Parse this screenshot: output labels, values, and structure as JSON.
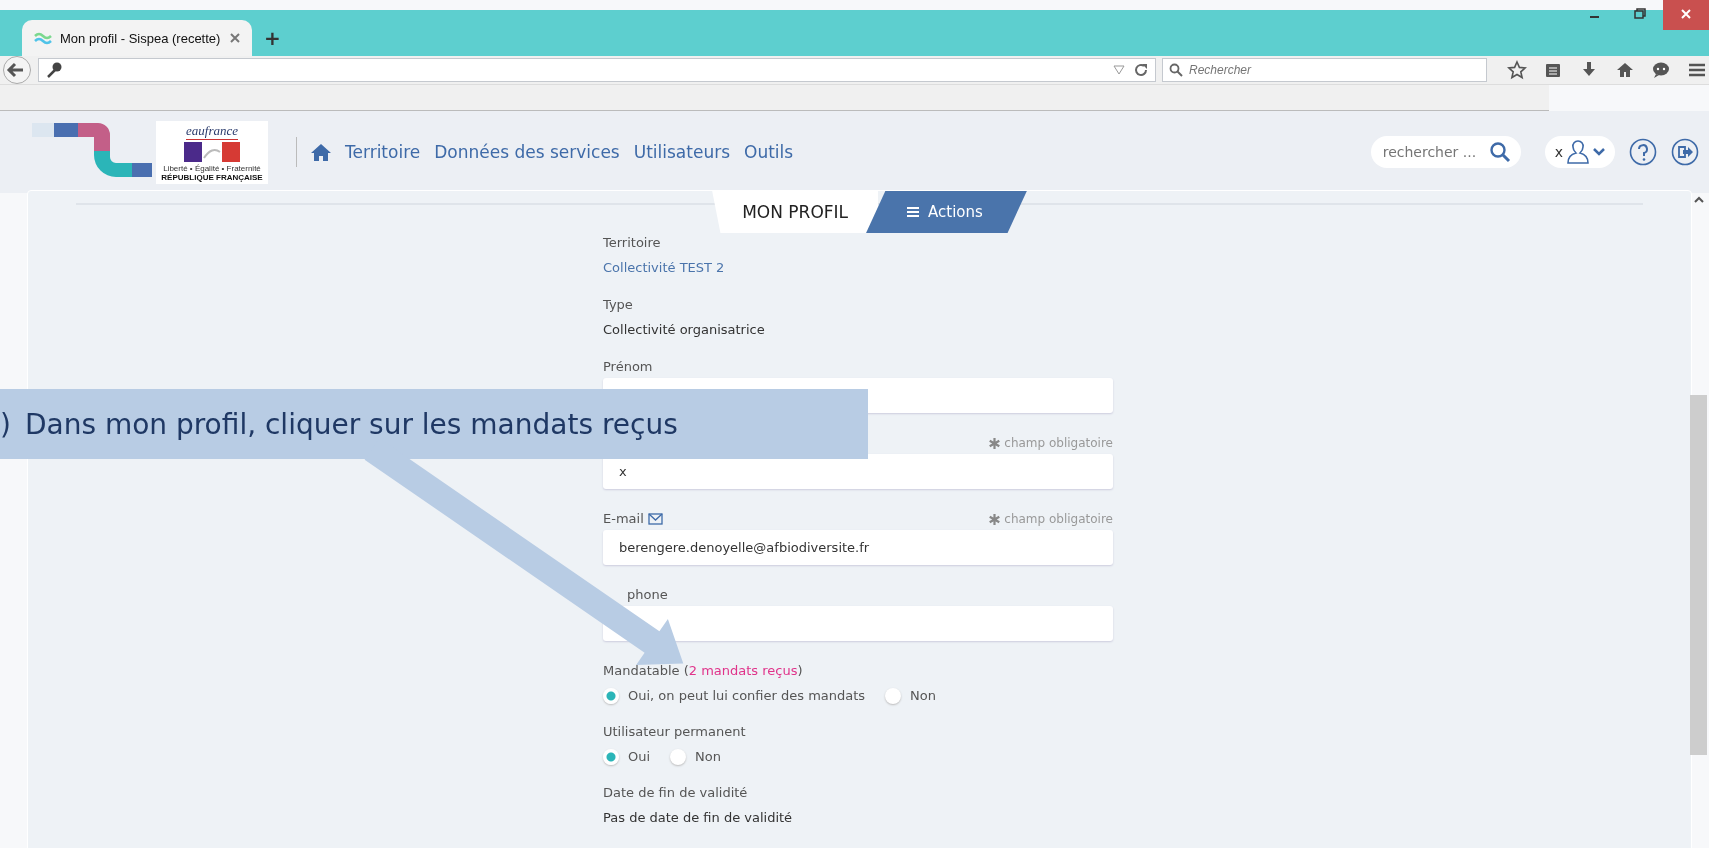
{
  "browser": {
    "tab_title": "Mon profil - Sispea (recette)",
    "new_tab": "+",
    "search_placeholder": "Rechercher"
  },
  "header": {
    "logo": {
      "brand": "eaufrance",
      "motto": "Liberté • Égalité • Fraternité",
      "republic": "RÉPUBLIQUE FRANÇAISE"
    },
    "nav": [
      "Territoire",
      "Données des services",
      "Utilisateurs",
      "Outils"
    ],
    "search_placeholder": "rechercher ...",
    "user": "x"
  },
  "profile_tabs": [
    {
      "label": "MON PROFIL",
      "kind": "tab",
      "selected": true
    },
    {
      "label": "Actions",
      "kind": "menu",
      "selected": false
    }
  ],
  "fields": [
    {
      "kind": "display",
      "label": "Territoire",
      "value": "Collectivité TEST 2",
      "link": true
    },
    {
      "kind": "display",
      "label": "Type",
      "value": "Collectivité organisatrice",
      "link": false
    },
    {
      "kind": "input",
      "label": "Prénom"
    },
    {
      "kind": "input",
      "required": "champ obligatoire",
      "value": "x"
    },
    {
      "kind": "input",
      "label": "E-mail",
      "mail_icon": true,
      "required": "champ obligatoire",
      "value": "berengere.denoyelle@afbiodiversite.fr"
    },
    {
      "kind": "input",
      "label": "phone"
    },
    {
      "kind": "radio",
      "label": "Mandatable (",
      "link": "2 mandats reçus",
      "suffix": ")",
      "options": [
        {
          "label": "Oui, on peut lui confier des mandats",
          "selected": true
        },
        {
          "label": "Non",
          "selected": false
        }
      ]
    },
    {
      "kind": "radio",
      "label": "Utilisateur permanent",
      "options": [
        {
          "label": "Oui",
          "selected": true
        },
        {
          "label": "Non",
          "selected": false
        }
      ]
    },
    {
      "kind": "display",
      "label": "Date de fin de validité",
      "value": "Pas de date de fin de validité",
      "link": false
    }
  ],
  "callout": {
    "number": ")",
    "text": "Dans mon profil, cliquer sur les mandats reçus"
  }
}
